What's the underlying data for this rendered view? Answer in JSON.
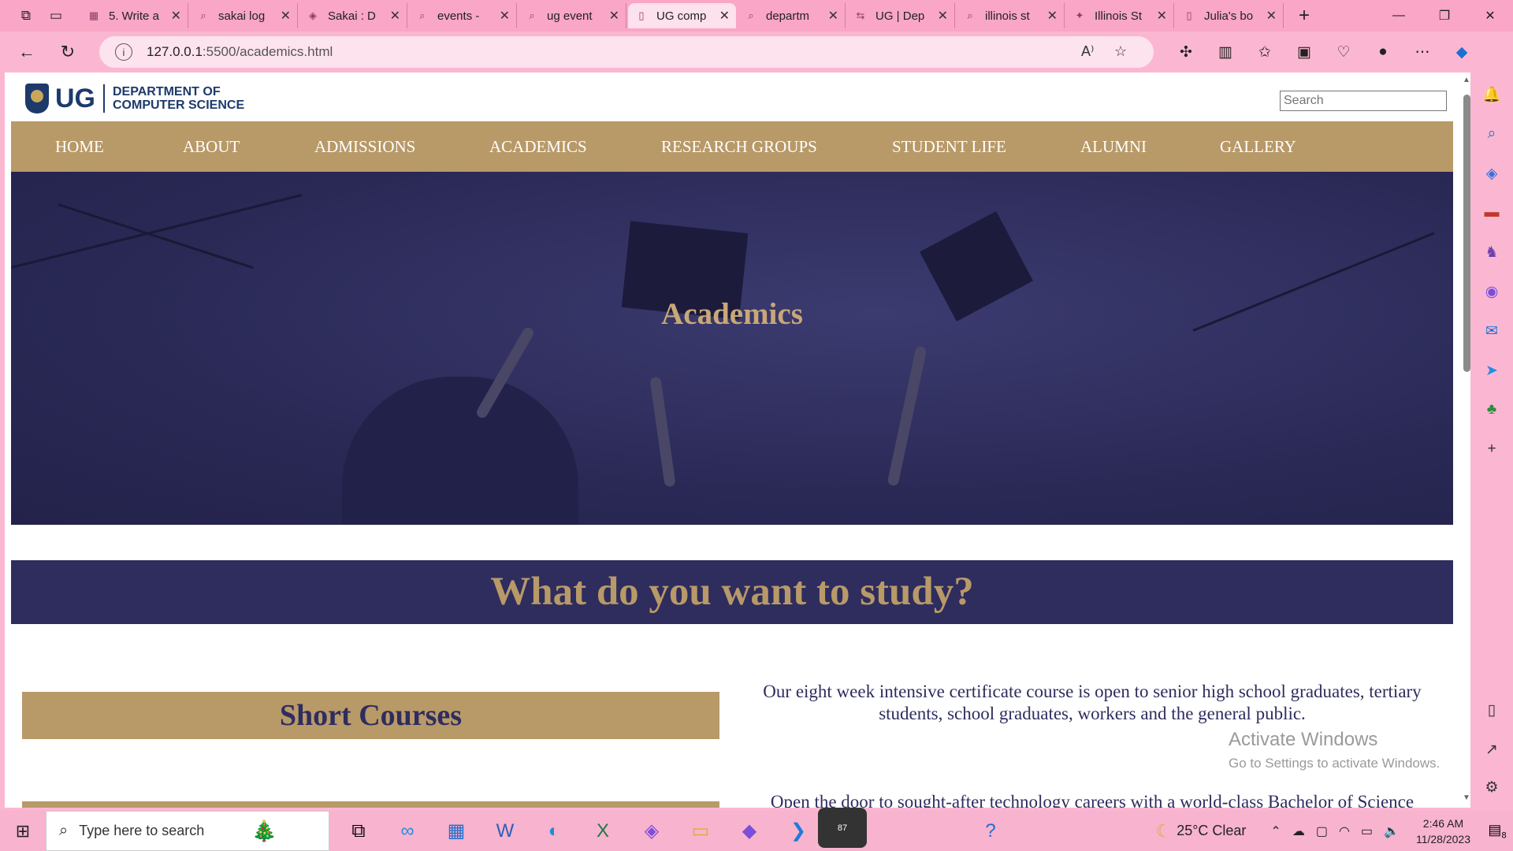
{
  "browser": {
    "tabs": [
      {
        "label": "5. Write a",
        "icon": "book-icon"
      },
      {
        "label": "sakai log",
        "icon": "search-icon"
      },
      {
        "label": "Sakai : D",
        "icon": "shield-icon"
      },
      {
        "label": "events -",
        "icon": "search-icon"
      },
      {
        "label": "ug event",
        "icon": "search-icon"
      },
      {
        "label": "UG comp",
        "icon": "page-icon",
        "active": true
      },
      {
        "label": "departm",
        "icon": "search-icon"
      },
      {
        "label": "UG | Dep",
        "icon": "link-icon"
      },
      {
        "label": "illinois st",
        "icon": "search-icon"
      },
      {
        "label": "Illinois St",
        "icon": "bird-icon"
      },
      {
        "label": "Julia's bo",
        "icon": "page-icon"
      }
    ],
    "url_host": "127.0.0.1",
    "url_path": ":5500/academics.html"
  },
  "site": {
    "logo_ug": "UG",
    "logo_line1": "DEPARTMENT OF",
    "logo_line2": "COMPUTER SCIENCE",
    "search_placeholder": "Search",
    "nav": [
      "HOME",
      "ABOUT",
      "ADMISSIONS",
      "ACADEMICS",
      "RESEARCH GROUPS",
      "STUDENT LIFE",
      "ALUMNI",
      "GALLERY"
    ],
    "hero_title": "Academics",
    "band_title": "What do you want to study?",
    "course1_title": "Short Courses",
    "course1_text": "Our eight week intensive certificate course is open to senior high school graduates, tertiary students, school graduates, workers and the general public.",
    "course2_text": "Open the door to sought-after technology careers with a world-class Bachelor of Science"
  },
  "watermark": {
    "line1": "Activate Windows",
    "line2": "Go to Settings to activate Windows."
  },
  "taskbar": {
    "search_text": "Type here to search",
    "weather": "25°C  Clear",
    "time": "2:46 AM",
    "date": "11/28/2023",
    "whatsapp_badge": "87",
    "notif_count": "8"
  },
  "colors": {
    "navy": "#2e2d5e",
    "gold": "#b89968",
    "chrome_pink": "#f9a6c7"
  }
}
